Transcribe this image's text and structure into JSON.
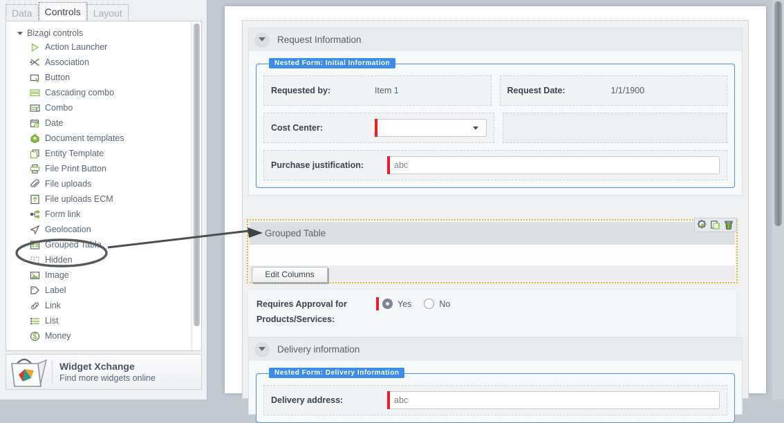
{
  "panel": {
    "tabs": [
      {
        "label": "Data",
        "active": false
      },
      {
        "label": "Controls",
        "active": true
      },
      {
        "label": "Layout",
        "active": false
      }
    ],
    "group_label": "Bizagi controls",
    "items": [
      {
        "label": "Action Launcher",
        "icon": "play-triangle-icon"
      },
      {
        "label": "Association",
        "icon": "association-icon"
      },
      {
        "label": "Button",
        "icon": "button-icon"
      },
      {
        "label": "Cascading combo",
        "icon": "cascading-combo-icon"
      },
      {
        "label": "Combo",
        "icon": "combo-icon"
      },
      {
        "label": "Date",
        "icon": "calendar-clock-icon"
      },
      {
        "label": "Document templates",
        "icon": "document-templates-icon"
      },
      {
        "label": "Entity Template",
        "icon": "entity-template-icon"
      },
      {
        "label": "File Print Button",
        "icon": "printer-icon"
      },
      {
        "label": "File uploads",
        "icon": "paperclip-icon"
      },
      {
        "label": "File uploads ECM",
        "icon": "upload-arrow-icon"
      },
      {
        "label": "Form link",
        "icon": "form-link-icon"
      },
      {
        "label": "Geolocation",
        "icon": "geolocation-arrow-icon"
      },
      {
        "label": "Grouped Table",
        "icon": "grouped-table-icon",
        "highlighted": true
      },
      {
        "label": "Hidden",
        "icon": "hidden-icon"
      },
      {
        "label": "Image",
        "icon": "image-icon"
      },
      {
        "label": "Label",
        "icon": "tag-icon"
      },
      {
        "label": "Link",
        "icon": "link-chain-icon"
      },
      {
        "label": "List",
        "icon": "list-icon"
      },
      {
        "label": "Money",
        "icon": "money-icon"
      }
    ],
    "widget_xchange": {
      "title": "Widget Xchange",
      "subtitle": "Find more widgets online",
      "icon": "shopping-bag-icon"
    }
  },
  "form": {
    "sections": [
      {
        "title": "Request Information",
        "nested_form_badge": "Nested Form: Initial Information",
        "rows": [
          {
            "cells": [
              {
                "label": "Requested by:",
                "value_prefix": "Item ",
                "value_accent": "1",
                "kind": "text"
              },
              {
                "label": "Request Date:",
                "value": "1/1/1900",
                "kind": "text"
              }
            ]
          },
          {
            "cells": [
              {
                "label": "Cost Center:",
                "value": "",
                "kind": "combo"
              },
              {
                "label": "",
                "value": "",
                "kind": "empty"
              }
            ]
          },
          {
            "cells": [
              {
                "label": "Purchase justification:",
                "value": "abc",
                "kind": "input-wide"
              }
            ]
          }
        ]
      }
    ],
    "grouped_table": {
      "title": "Grouped Table",
      "edit_columns_label": "Edit Columns",
      "toolbar": [
        {
          "name": "gear-icon",
          "title": "Properties"
        },
        {
          "name": "copy-icon",
          "title": "Duplicate"
        },
        {
          "name": "trash-icon",
          "title": "Delete"
        }
      ],
      "selection_color": "#e0b424"
    },
    "approval": {
      "label_line1": "Requires Approval for",
      "label_line2": "Products/Services:",
      "options": [
        {
          "label": "Yes",
          "selected": true
        },
        {
          "label": "No",
          "selected": false
        }
      ]
    },
    "delivery_section": {
      "title": "Delivery information",
      "nested_form_badge": "Nested Form: Delivery Information",
      "field_label": "Delivery address:",
      "field_value": "abc"
    }
  },
  "colors": {
    "accent_blue": "#3d8ceb",
    "required_red": "#ee1c25",
    "selection_yellow": "#e0b424",
    "icon_green": "#8cbf3f",
    "value_blue": "#2f6fba"
  }
}
